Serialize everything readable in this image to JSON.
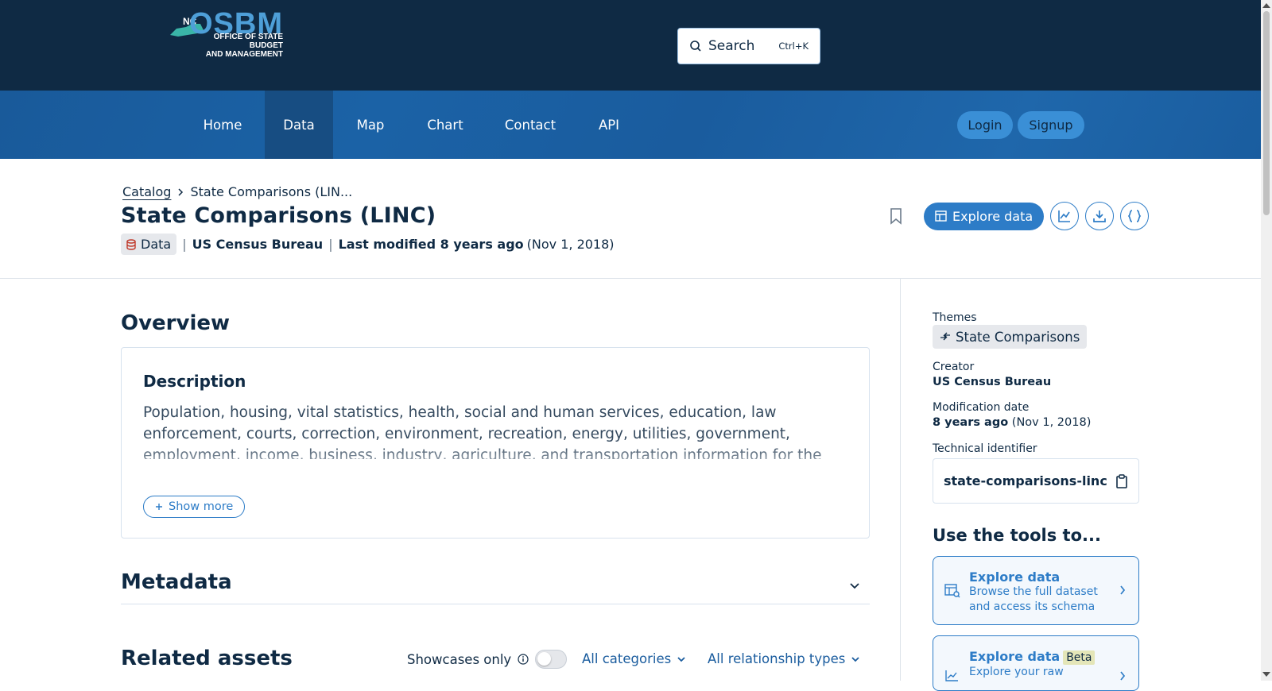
{
  "header": {
    "logo_nc": "NC",
    "logo_name": "OSBM",
    "logo_subtitle_line1": "OFFICE OF STATE BUDGET",
    "logo_subtitle_line2": "AND MANAGEMENT",
    "search_label": "Search",
    "search_shortcut": "Ctrl+K"
  },
  "nav": {
    "items": [
      {
        "label": "Home"
      },
      {
        "label": "Data"
      },
      {
        "label": "Map"
      },
      {
        "label": "Chart"
      },
      {
        "label": "Contact"
      },
      {
        "label": "API"
      }
    ],
    "active": "Data",
    "login": "Login",
    "signup": "Signup"
  },
  "page": {
    "breadcrumb": {
      "root": "Catalog",
      "current": "State Comparisons (LIN..."
    },
    "title": "State Comparisons (LINC)",
    "type_chip": "Data",
    "source": "US Census Bureau",
    "modified_label": "Last modified 8 years ago",
    "modified_date": "(Nov 1, 2018)",
    "explore_button": "Explore data"
  },
  "overview": {
    "heading": "Overview",
    "description_heading": "Description",
    "description_text": "Population, housing, vital statistics, health, social and human services, education, law enforcement, courts, correction, environment, recreation, energy, utilities, government, employment, income, business, industry, agriculture, and transportation information for the United States and all states.",
    "show_more": "Show more"
  },
  "metadata": {
    "heading": "Metadata"
  },
  "related": {
    "heading": "Related assets",
    "showcases_label": "Showcases only",
    "categories_dropdown": "All categories",
    "relationship_dropdown": "All relationship types"
  },
  "sidebar": {
    "themes_label": "Themes",
    "theme_value": "State Comparisons",
    "creator_label": "Creator",
    "creator_value": "US Census Bureau",
    "modification_label": "Modification date",
    "modification_value": "8 years ago",
    "modification_date": "(Nov 1, 2018)",
    "technical_label": "Technical identifier",
    "technical_value": "state-comparisons-linc",
    "tools_heading": "Use the tools to...",
    "tools": [
      {
        "title": "Explore data",
        "badge": "",
        "description": "Browse the full dataset and access its schema"
      },
      {
        "title": "Explore data",
        "badge": "Beta",
        "description": "Explore your raw"
      }
    ]
  },
  "colors": {
    "topbar": "#0f2a44",
    "navbar": "#1a5c9e",
    "accent": "#2d7cc7",
    "pill": "#3a8fd6"
  }
}
